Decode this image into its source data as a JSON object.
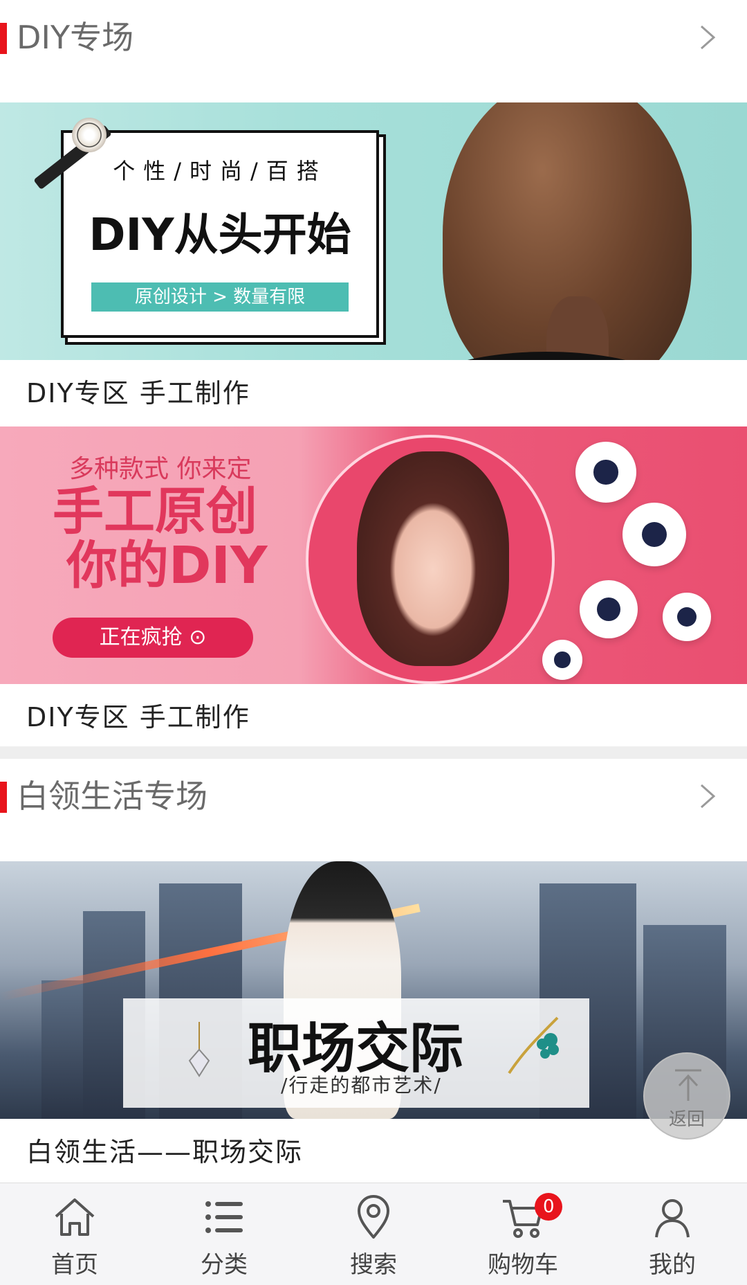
{
  "sections": [
    {
      "title": "DIY专场",
      "items": [
        {
          "caption": "DIY专区  手工制作",
          "banner": {
            "line1": "个性/时尚/百搭",
            "line2": "DIY从头开始",
            "line3": "原创设计 > 数量有限"
          }
        },
        {
          "caption": "DIY专区  手工制作",
          "banner": {
            "line1": "多种款式 你来定",
            "line2": "手工原创",
            "line3": "你的DIY",
            "button": "正在疯抢 ⊙"
          }
        }
      ]
    },
    {
      "title": "白领生活专场",
      "items": [
        {
          "caption": "白领生活——职场交际",
          "banner": {
            "line1": "职场交际",
            "line2": "/行走的都市艺术/"
          }
        }
      ]
    }
  ],
  "back_to_top": {
    "label": "返回",
    "icon": "arrow-up-icon"
  },
  "bottom_nav": {
    "items": [
      {
        "label": "首页",
        "icon": "home-icon"
      },
      {
        "label": "分类",
        "icon": "list-icon"
      },
      {
        "label": "搜索",
        "icon": "location-pin-icon"
      },
      {
        "label": "购物车",
        "icon": "cart-icon",
        "badge": "0"
      },
      {
        "label": "我的",
        "icon": "user-icon"
      }
    ]
  },
  "colors": {
    "accent": "#e8141c",
    "badge": "#e8141c"
  }
}
